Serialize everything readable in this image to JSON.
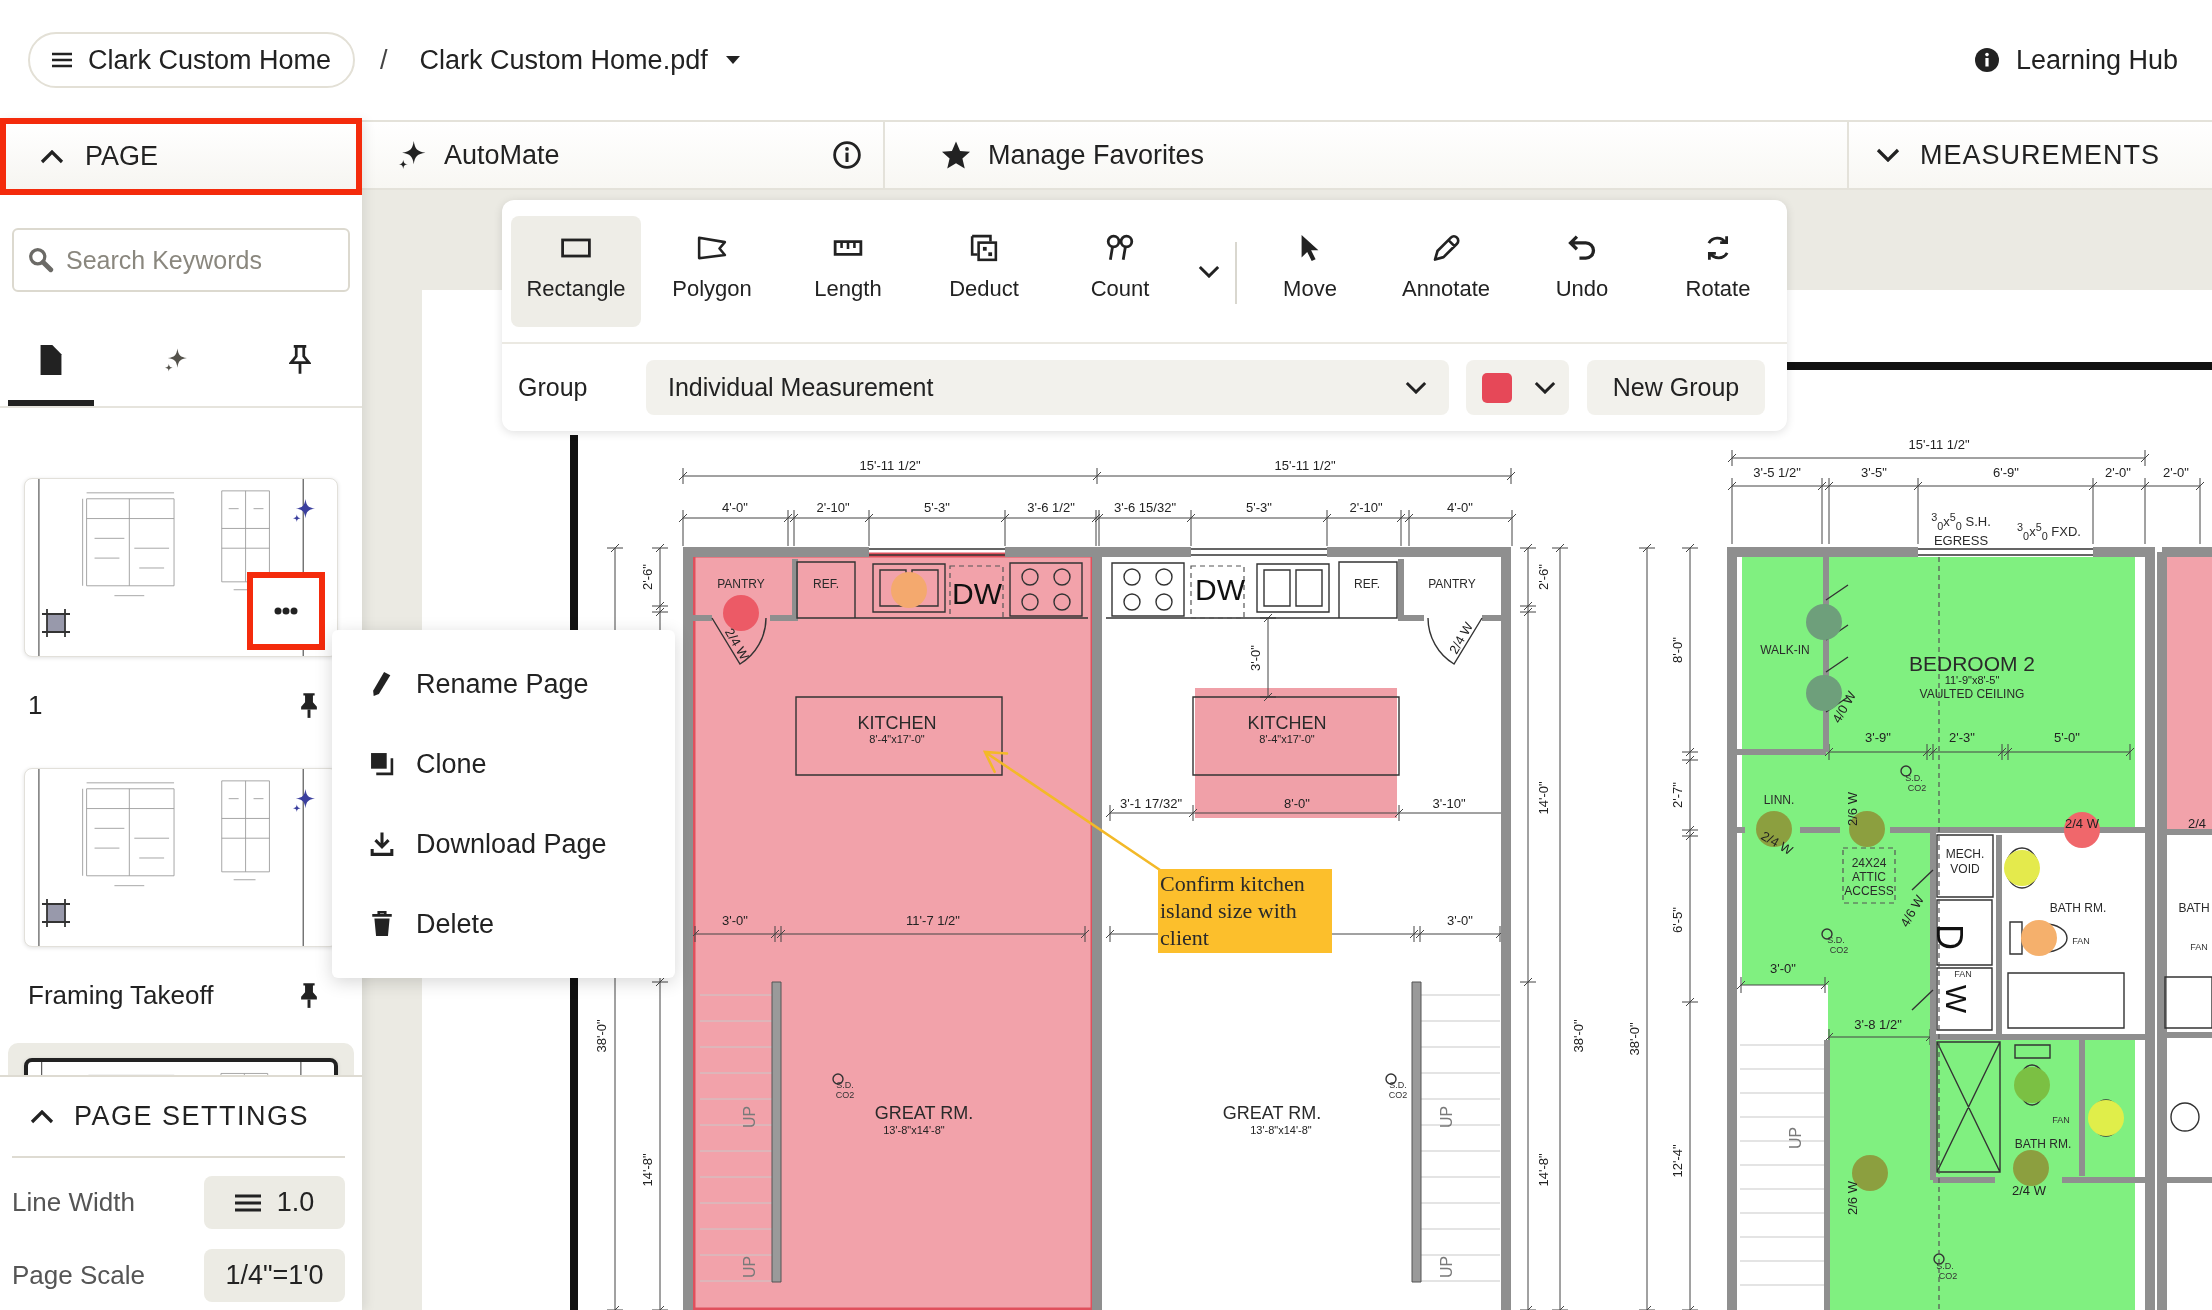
{
  "breadcrumb": {
    "project": "Clark Custom Home",
    "separator": "/",
    "file": "Clark Custom Home.pdf"
  },
  "help_link": {
    "label": "Learning Hub"
  },
  "page_panel": {
    "title": "PAGE",
    "expanded": true,
    "highlighted": true,
    "search": {
      "placeholder": "Search Keywords"
    },
    "tabs": [
      {
        "kind": "pages",
        "selected": true
      },
      {
        "kind": "ai",
        "selected": false
      },
      {
        "kind": "pinned",
        "selected": false
      }
    ],
    "pages": [
      {
        "label": "1",
        "selected": false,
        "more_button": {
          "highlighted": true
        }
      },
      {
        "label": "Framing Takeoff",
        "selected": false
      },
      {
        "selected": true
      }
    ],
    "page_menu": {
      "items": [
        {
          "kind": "rename",
          "label": "Rename Page"
        },
        {
          "kind": "clone",
          "label": "Clone"
        },
        {
          "kind": "download",
          "label": "Download Page"
        },
        {
          "kind": "delete",
          "label": "Delete"
        }
      ]
    }
  },
  "page_settings": {
    "title": "PAGE SETTINGS",
    "expanded": true,
    "rows": [
      {
        "kind": "line_width",
        "label": "Line Width",
        "value": "1.0"
      },
      {
        "kind": "scale",
        "label": "Page Scale",
        "value": "1/4\"=1'0"
      }
    ]
  },
  "automate": {
    "label": "AutoMate"
  },
  "favorites": {
    "label": "Manage Favorites"
  },
  "measurements_panel": {
    "title": "MEASUREMENTS",
    "expanded": false
  },
  "toolbar": {
    "tool_groups": [
      {
        "more": true,
        "tools": [
          {
            "kind": "rectangle",
            "label": "Rectangle",
            "selected": true
          },
          {
            "kind": "polygon",
            "label": "Polygon",
            "selected": false
          },
          {
            "kind": "length",
            "label": "Length",
            "selected": false
          },
          {
            "kind": "deduct",
            "label": "Deduct",
            "selected": false
          },
          {
            "kind": "count",
            "label": "Count",
            "selected": false
          }
        ]
      },
      {
        "more": false,
        "tools": [
          {
            "kind": "move",
            "label": "Move",
            "selected": false
          },
          {
            "kind": "annotate",
            "label": "Annotate",
            "selected": false
          },
          {
            "kind": "undo",
            "label": "Undo",
            "selected": false
          },
          {
            "kind": "rotate",
            "label": "Rotate",
            "selected": false
          }
        ]
      }
    ],
    "group": {
      "label": "Group",
      "value": "Individual Measurement",
      "color": "#e64858"
    },
    "new_group": {
      "label": "New Group"
    }
  },
  "plan": {
    "areas": [
      {
        "color": "#f2a2aa",
        "selected": true
      },
      {
        "color": "#f0a0a8",
        "selected": false
      },
      {
        "color": "#80f080",
        "selected": false
      },
      {
        "color": "#f2a2aa",
        "selected": false
      }
    ],
    "markers": [
      {
        "color": "#ec5a66"
      },
      {
        "color": "#f4a96e"
      },
      {
        "color": "#6e9f7b"
      },
      {
        "color": "#6e9f7b"
      },
      {
        "color": "#8c9f3f"
      },
      {
        "color": "#8c9f3f"
      },
      {
        "color": "#f0676b"
      },
      {
        "color": "#e4ea4c"
      },
      {
        "color": "#f5b06c"
      },
      {
        "color": "#7bc043"
      },
      {
        "color": "#e0ee4a"
      },
      {
        "color": "#8c9f3f"
      },
      {
        "color": "#8c9f3f"
      }
    ],
    "labels": [
      {
        "kind": "dimension",
        "text": "15'-11 1/2\""
      },
      {
        "kind": "dimension",
        "text": "15'-11 1/2\""
      },
      {
        "kind": "dimension",
        "text": "15'-11 1/2\""
      },
      {
        "kind": "dimension",
        "text": "4'-0\""
      },
      {
        "kind": "dimension",
        "text": "2'-10\""
      },
      {
        "kind": "dimension",
        "text": "5'-3\""
      },
      {
        "kind": "dimension",
        "text": "3'-6 1/2\""
      },
      {
        "kind": "dimension",
        "text": "3'-6 15/32\""
      },
      {
        "kind": "dimension",
        "text": "5'-3\""
      },
      {
        "kind": "dimension",
        "text": "2'-10\""
      },
      {
        "kind": "dimension",
        "text": "4'-0\""
      },
      {
        "kind": "dimension",
        "text": "3'-5 1/2\""
      },
      {
        "kind": "dimension",
        "text": "3'-5\""
      },
      {
        "kind": "dimension",
        "text": "6'-9\""
      },
      {
        "kind": "dimension",
        "text": "2'-0\""
      },
      {
        "kind": "dimension",
        "text": "2'-0\""
      },
      {
        "kind": "room",
        "text": "$^{3}$$_{0}$x$^{5}$$_{0}$ S.H."
      },
      {
        "kind": "room",
        "text": "EGRESS"
      },
      {
        "kind": "room",
        "text": "$^{3}$$_{0}$x$^{5}$$_{0}$ FXD."
      },
      {
        "kind": "dimension",
        "text": "2'-6\""
      },
      {
        "kind": "dimension",
        "text": "2'-6\""
      },
      {
        "kind": "room",
        "text": "PANTRY"
      },
      {
        "kind": "room",
        "text": "REF."
      },
      {
        "kind": "fixture",
        "text": "DW"
      },
      {
        "kind": "fixture",
        "text": "DW"
      },
      {
        "kind": "room",
        "text": "REF."
      },
      {
        "kind": "room",
        "text": "PANTRY"
      },
      {
        "kind": "dimension",
        "text": "2/4 W"
      },
      {
        "kind": "dimension",
        "text": "2/4 W"
      },
      {
        "kind": "dimension",
        "text": "3'-0\""
      },
      {
        "kind": "room",
        "text": "KITCHEN"
      },
      {
        "kind": "dimension",
        "text": "8'-4\"x17'-0\""
      },
      {
        "kind": "room",
        "text": "KITCHEN"
      },
      {
        "kind": "dimension",
        "text": "8'-4\"x17'-0\""
      },
      {
        "kind": "dimension",
        "text": "3'-1 17/32\""
      },
      {
        "kind": "dimension",
        "text": "8'-0\""
      },
      {
        "kind": "dimension",
        "text": "3'-10\""
      },
      {
        "kind": "dimension",
        "text": "14'-0\""
      },
      {
        "kind": "dimension",
        "text": "3'-0\""
      },
      {
        "kind": "dimension",
        "text": "11'-7 1/2\""
      },
      {
        "kind": "dimension",
        "text": "3'-0\""
      },
      {
        "kind": "dimension",
        "text": "38'-0\""
      },
      {
        "kind": "dimension",
        "text": "38'-0\""
      },
      {
        "kind": "detector",
        "text": "S.D."
      },
      {
        "kind": "detector",
        "text": "CO2"
      },
      {
        "kind": "detector",
        "text": "S.D."
      },
      {
        "kind": "detector",
        "text": "CO2"
      },
      {
        "kind": "room",
        "text": "GREAT RM."
      },
      {
        "kind": "dimension",
        "text": "13'-8\"x14'-8\""
      },
      {
        "kind": "room",
        "text": "GREAT RM."
      },
      {
        "kind": "dimension",
        "text": "13'-8\"x14'-8\""
      },
      {
        "kind": "dimension",
        "text": "14'-8\""
      },
      {
        "kind": "dimension",
        "text": "14'-8\""
      },
      {
        "kind": "stair",
        "text": "UP"
      },
      {
        "kind": "stair",
        "text": "UP"
      },
      {
        "kind": "stair",
        "text": "UP"
      },
      {
        "kind": "stair",
        "text": "UP"
      },
      {
        "kind": "dimension",
        "text": "8'-0\""
      },
      {
        "kind": "room",
        "text": "WALK-IN"
      },
      {
        "kind": "room",
        "text": "BEDROOM 2"
      },
      {
        "kind": "dimension",
        "text": "11'-9\"x8'-5\""
      },
      {
        "kind": "room",
        "text": "VAULTED CEILING"
      },
      {
        "kind": "dimension",
        "text": "4/0 W"
      },
      {
        "kind": "dimension",
        "text": "3'-9\""
      },
      {
        "kind": "dimension",
        "text": "2'-3\""
      },
      {
        "kind": "dimension",
        "text": "5'-0\""
      },
      {
        "kind": "detector",
        "text": "S.D."
      },
      {
        "kind": "detector",
        "text": "CO2"
      },
      {
        "kind": "dimension",
        "text": "2'-7\""
      },
      {
        "kind": "room",
        "text": "LINN."
      },
      {
        "kind": "dimension",
        "text": "2/6 W"
      },
      {
        "kind": "dimension",
        "text": "2/4 W"
      },
      {
        "kind": "dimension",
        "text": "2/4"
      },
      {
        "kind": "dimension",
        "text": "2/4 W"
      },
      {
        "kind": "room",
        "text": "MECH."
      },
      {
        "kind": "room",
        "text": "VOID"
      },
      {
        "kind": "room",
        "text": "24X24"
      },
      {
        "kind": "room",
        "text": "ATTIC"
      },
      {
        "kind": "room",
        "text": "ACCESS"
      },
      {
        "kind": "room",
        "text": "BATH RM."
      },
      {
        "kind": "room",
        "text": "BATH"
      },
      {
        "kind": "dimension",
        "text": "4/6 W"
      },
      {
        "kind": "dimension",
        "text": "6'-5\""
      },
      {
        "kind": "detector",
        "text": "FAN"
      },
      {
        "kind": "detector",
        "text": "FAN"
      },
      {
        "kind": "detector",
        "text": "S.D."
      },
      {
        "kind": "detector",
        "text": "CO2"
      },
      {
        "kind": "fixture",
        "text": "D"
      },
      {
        "kind": "detector",
        "text": "FAN"
      },
      {
        "kind": "fixture",
        "text": "W"
      },
      {
        "kind": "dimension",
        "text": "3'-0\""
      },
      {
        "kind": "dimension",
        "text": "3'-8 1/2\""
      },
      {
        "kind": "dimension",
        "text": "38'-0\""
      },
      {
        "kind": "detector",
        "text": "FAN"
      },
      {
        "kind": "room",
        "text": "BATH RM."
      },
      {
        "kind": "dimension",
        "text": "12'-4\""
      },
      {
        "kind": "dimension",
        "text": "2/4 W"
      },
      {
        "kind": "dimension",
        "text": "2/6 W"
      },
      {
        "kind": "stair",
        "text": "UP"
      },
      {
        "kind": "detector",
        "text": "S.D."
      },
      {
        "kind": "detector",
        "text": "CO2"
      }
    ],
    "note": {
      "text": "Confirm kitchen island size with client"
    }
  }
}
